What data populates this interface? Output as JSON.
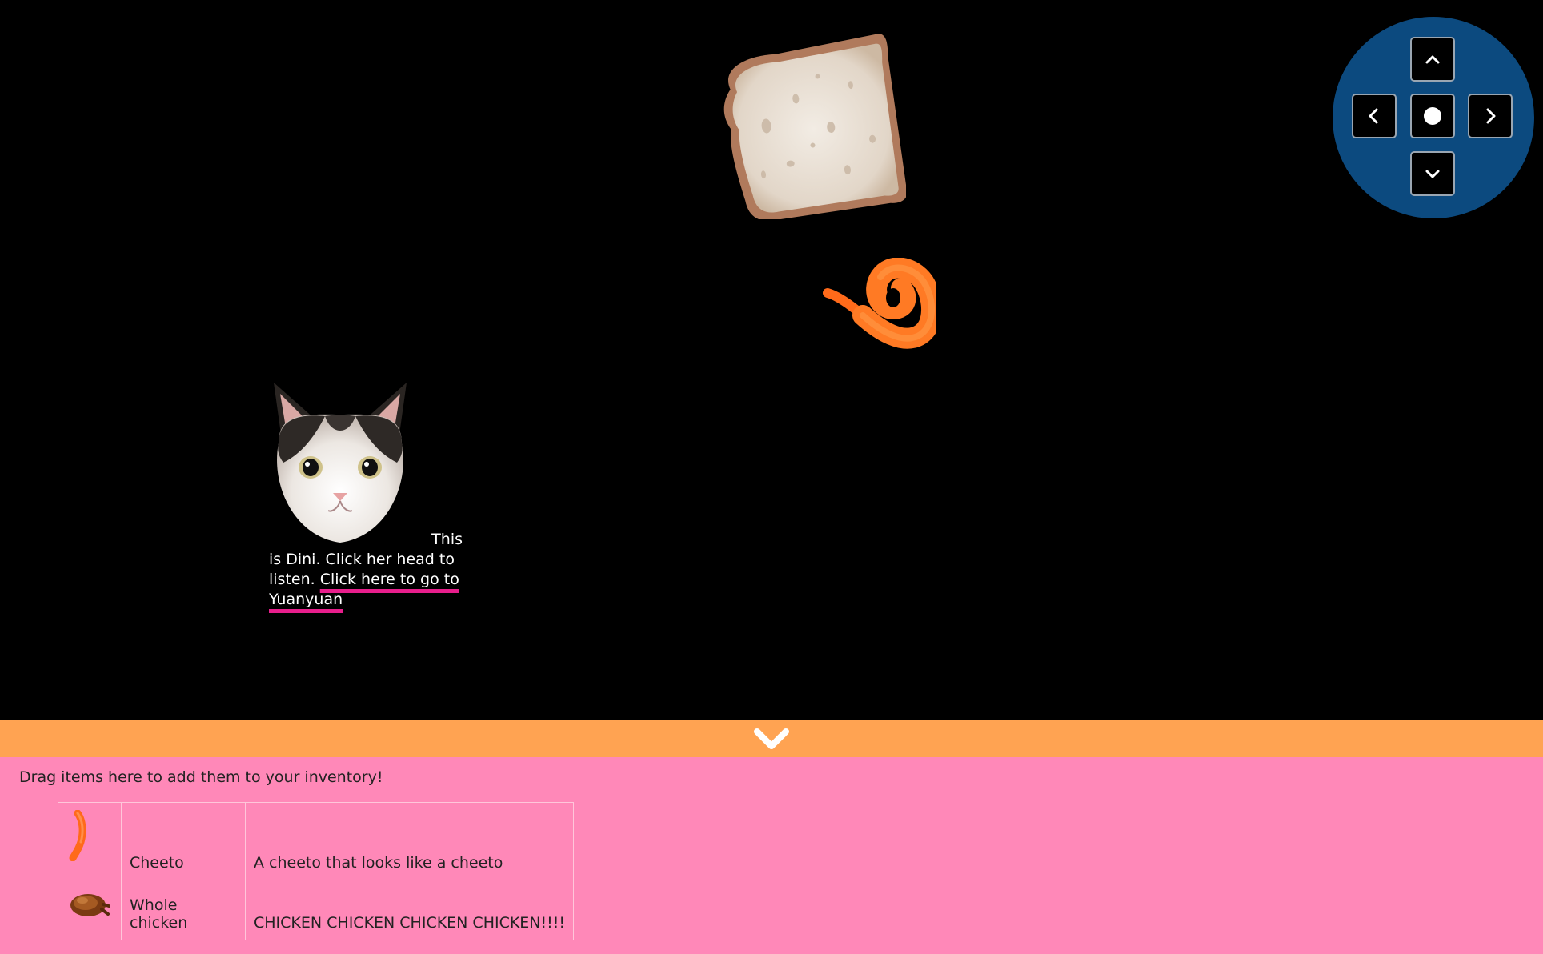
{
  "scene": {
    "caption": {
      "text_line1": "This",
      "text_rest": "is Dini. Click her head to listen.",
      "link_label": "Click here to go to Yuanyuan"
    },
    "items": [
      {
        "name": "bread-slice",
        "icon": "bread-icon"
      },
      {
        "name": "cheeto-curl",
        "icon": "cheeto-icon"
      },
      {
        "name": "cat-head",
        "icon": "cat-head-icon"
      }
    ]
  },
  "dpad": {
    "background": "#0c4a7f",
    "buttons": [
      "up",
      "left",
      "center",
      "right",
      "down"
    ]
  },
  "toggle_bar": {
    "color": "#ffa352",
    "icon": "chevron-down-icon"
  },
  "inventory": {
    "background": "#ff88b8",
    "hint": "Drag items here to add them to your inventory!",
    "rows": [
      {
        "icon": "cheeto-icon",
        "name": "Cheeto",
        "description": "A cheeto that looks like a cheeto"
      },
      {
        "icon": "chicken-icon",
        "name": "Whole chicken",
        "description": "CHICKEN CHICKEN CHICKEN CHICKEN!!!!"
      }
    ]
  }
}
